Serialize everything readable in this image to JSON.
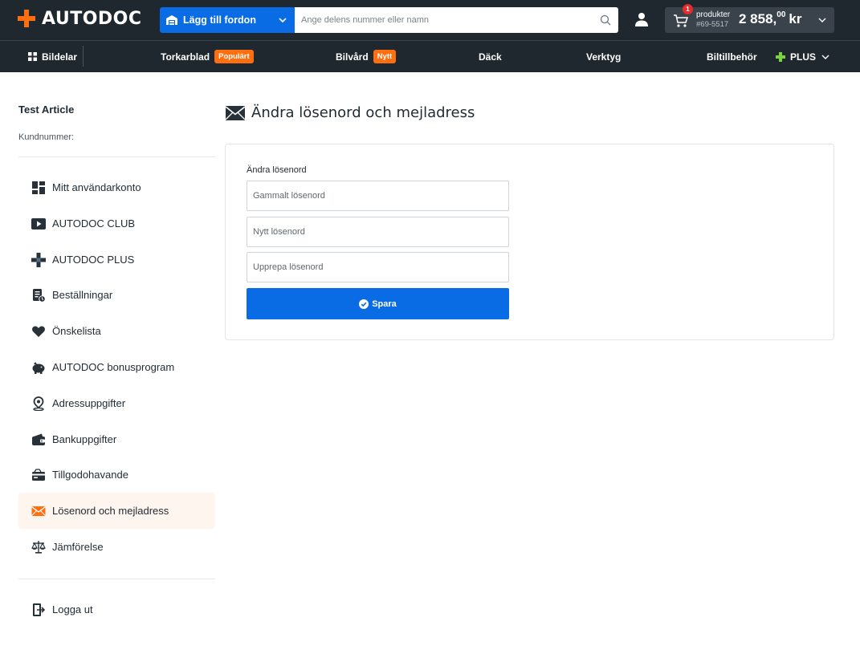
{
  "header": {
    "logo_text": "AUTODOC",
    "vehicle_button_label": "Lägg till fordon",
    "search_placeholder": "Ange delens nummer eller namn",
    "cart": {
      "count": "1",
      "products_label": "produkter",
      "code": "#69-5517",
      "price_main": "2 858,",
      "price_cents": "00",
      "currency": "kr"
    }
  },
  "nav": {
    "items": [
      {
        "label": "Bildelar"
      },
      {
        "label": "Torkarblad",
        "badge": "Populärt"
      },
      {
        "label": "Bilvård",
        "badge": "Nytt"
      },
      {
        "label": "Däck"
      },
      {
        "label": "Verktyg"
      },
      {
        "label": "Biltillbehör"
      },
      {
        "label": "PLUS"
      }
    ]
  },
  "sidebar": {
    "account_name": "Test Article",
    "customer_number_label": "Kundnummer:",
    "menu": [
      {
        "label": "Mitt användarkonto",
        "icon": "dashboard-icon"
      },
      {
        "label": "AUTODOC CLUB",
        "icon": "play-icon"
      },
      {
        "label": "AUTODOC PLUS",
        "icon": "plus-icon"
      },
      {
        "label": "Beställningar",
        "icon": "orders-icon"
      },
      {
        "label": "Önskelista",
        "icon": "heart-icon"
      },
      {
        "label": "AUTODOC bonusprogram",
        "icon": "piggy-bank-icon"
      },
      {
        "label": "Adressuppgifter",
        "icon": "location-pin-icon"
      },
      {
        "label": "Bankuppgifter",
        "icon": "wallet-icon"
      },
      {
        "label": "Tillgodohavande",
        "icon": "credit-card-icon"
      },
      {
        "label": "Lösenord och mejladress",
        "icon": "envelope-icon",
        "active": true
      },
      {
        "label": "Jämförelse",
        "icon": "scales-icon"
      }
    ],
    "logout_label": "Logga ut"
  },
  "main": {
    "title": "Ändra lösenord och mejladress",
    "form": {
      "section_label": "Ändra lösenord",
      "old_password_placeholder": "Gammalt lösenord",
      "new_password_placeholder": "Nytt lösenord",
      "repeat_password_placeholder": "Upprepa lösenord",
      "save_label": "Spara"
    }
  },
  "colors": {
    "header_bg": "#1f272f",
    "accent_blue": "#0a6ce5",
    "brand_orange": "#ff6e0f",
    "active_item_bg": "#fff5ef",
    "plus_green": "#7bd43c"
  }
}
